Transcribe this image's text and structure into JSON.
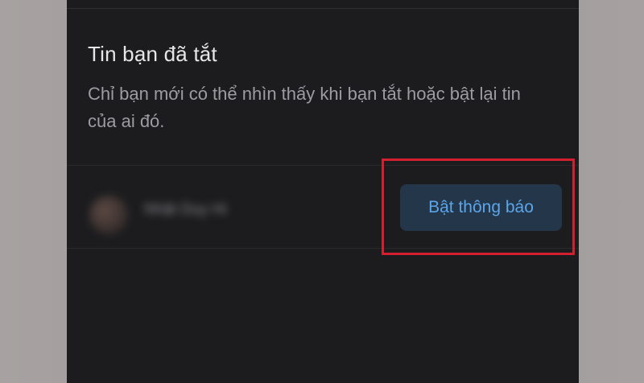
{
  "section": {
    "title": "Tin bạn đã tắt",
    "description": "Chỉ bạn mới có thể nhìn thấy khi bạn tắt hoặc bật lại tin của ai đó."
  },
  "contact": {
    "name": "Nhật Duy Hi"
  },
  "actions": {
    "enable_label": "Bật thông báo"
  },
  "colors": {
    "background": "#1c1c1e",
    "button_bg": "#24364a",
    "button_text": "#5ba5ea",
    "highlight": "#d32030"
  }
}
